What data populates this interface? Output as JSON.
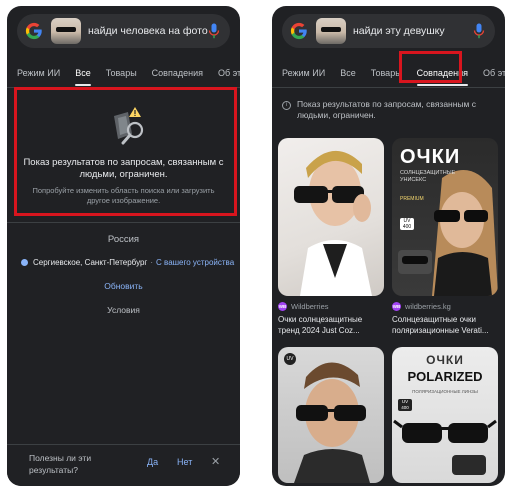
{
  "left": {
    "search": {
      "query": "найди человека на фото"
    },
    "tabs": [
      "Режим ИИ",
      "Все",
      "Товары",
      "Совпадения",
      "Об этом и"
    ],
    "active_tab": "Все",
    "notice": {
      "title": "Показ результатов по запросам, связанным с людьми, ограничен.",
      "subtitle": "Попробуйте изменить область поиска или загрузить другое изображение."
    },
    "footer": {
      "region": "Россия",
      "location": "Сергиевское, Санкт-Петербург",
      "location_separator": "·",
      "location_source": "С вашего устройства",
      "update": "Обновить",
      "terms": "Условия"
    },
    "feedback": {
      "question": "Полезны ли эти результаты?",
      "yes": "Да",
      "no": "Нет",
      "close": "✕"
    }
  },
  "right": {
    "search": {
      "query": "найди эту девушку"
    },
    "tabs": [
      "Режим ИИ",
      "Все",
      "Товары",
      "Совпадения",
      "Об этом и"
    ],
    "active_tab": "Совпадения",
    "info": "Показ результатов по запросам, связанным с людьми, ограничен.",
    "cards": [
      {
        "source_badge": "WB",
        "source": "Wildberries",
        "title": "Очки солнцезащитные тренд 2024 Just Coz..."
      },
      {
        "source_badge": "WB",
        "source": "wildberries.kg",
        "title": "Солнцезащитные очки поляризационные Verati...",
        "image_text": {
          "headline": "ОЧКИ",
          "sub": "СОЛНЦЕЗАЩИТНЫЕ УНИСЕКС",
          "badge1": "PREMIUM",
          "badge2": "UV 400"
        }
      },
      {
        "source_badge": "",
        "source": "",
        "title": "",
        "image_text": {
          "badge": "UV"
        }
      },
      {
        "source_badge": "",
        "source": "",
        "title": "",
        "image_text": {
          "headline": "ОЧКИ",
          "brand": "POLARIZED",
          "sub": "ПОЛЯРИЗАЦИОННЫЕ ЛИНЗЫ",
          "badge": "UV 400"
        }
      }
    ]
  },
  "colors": {
    "background": "#202124",
    "highlight": "#d8151e",
    "link": "#8ab4f8",
    "badge": "#a142f4"
  },
  "icons": [
    "google-logo-icon",
    "microphone-icon",
    "info-icon",
    "close-icon",
    "magnifier-icon",
    "location-dot-icon"
  ]
}
